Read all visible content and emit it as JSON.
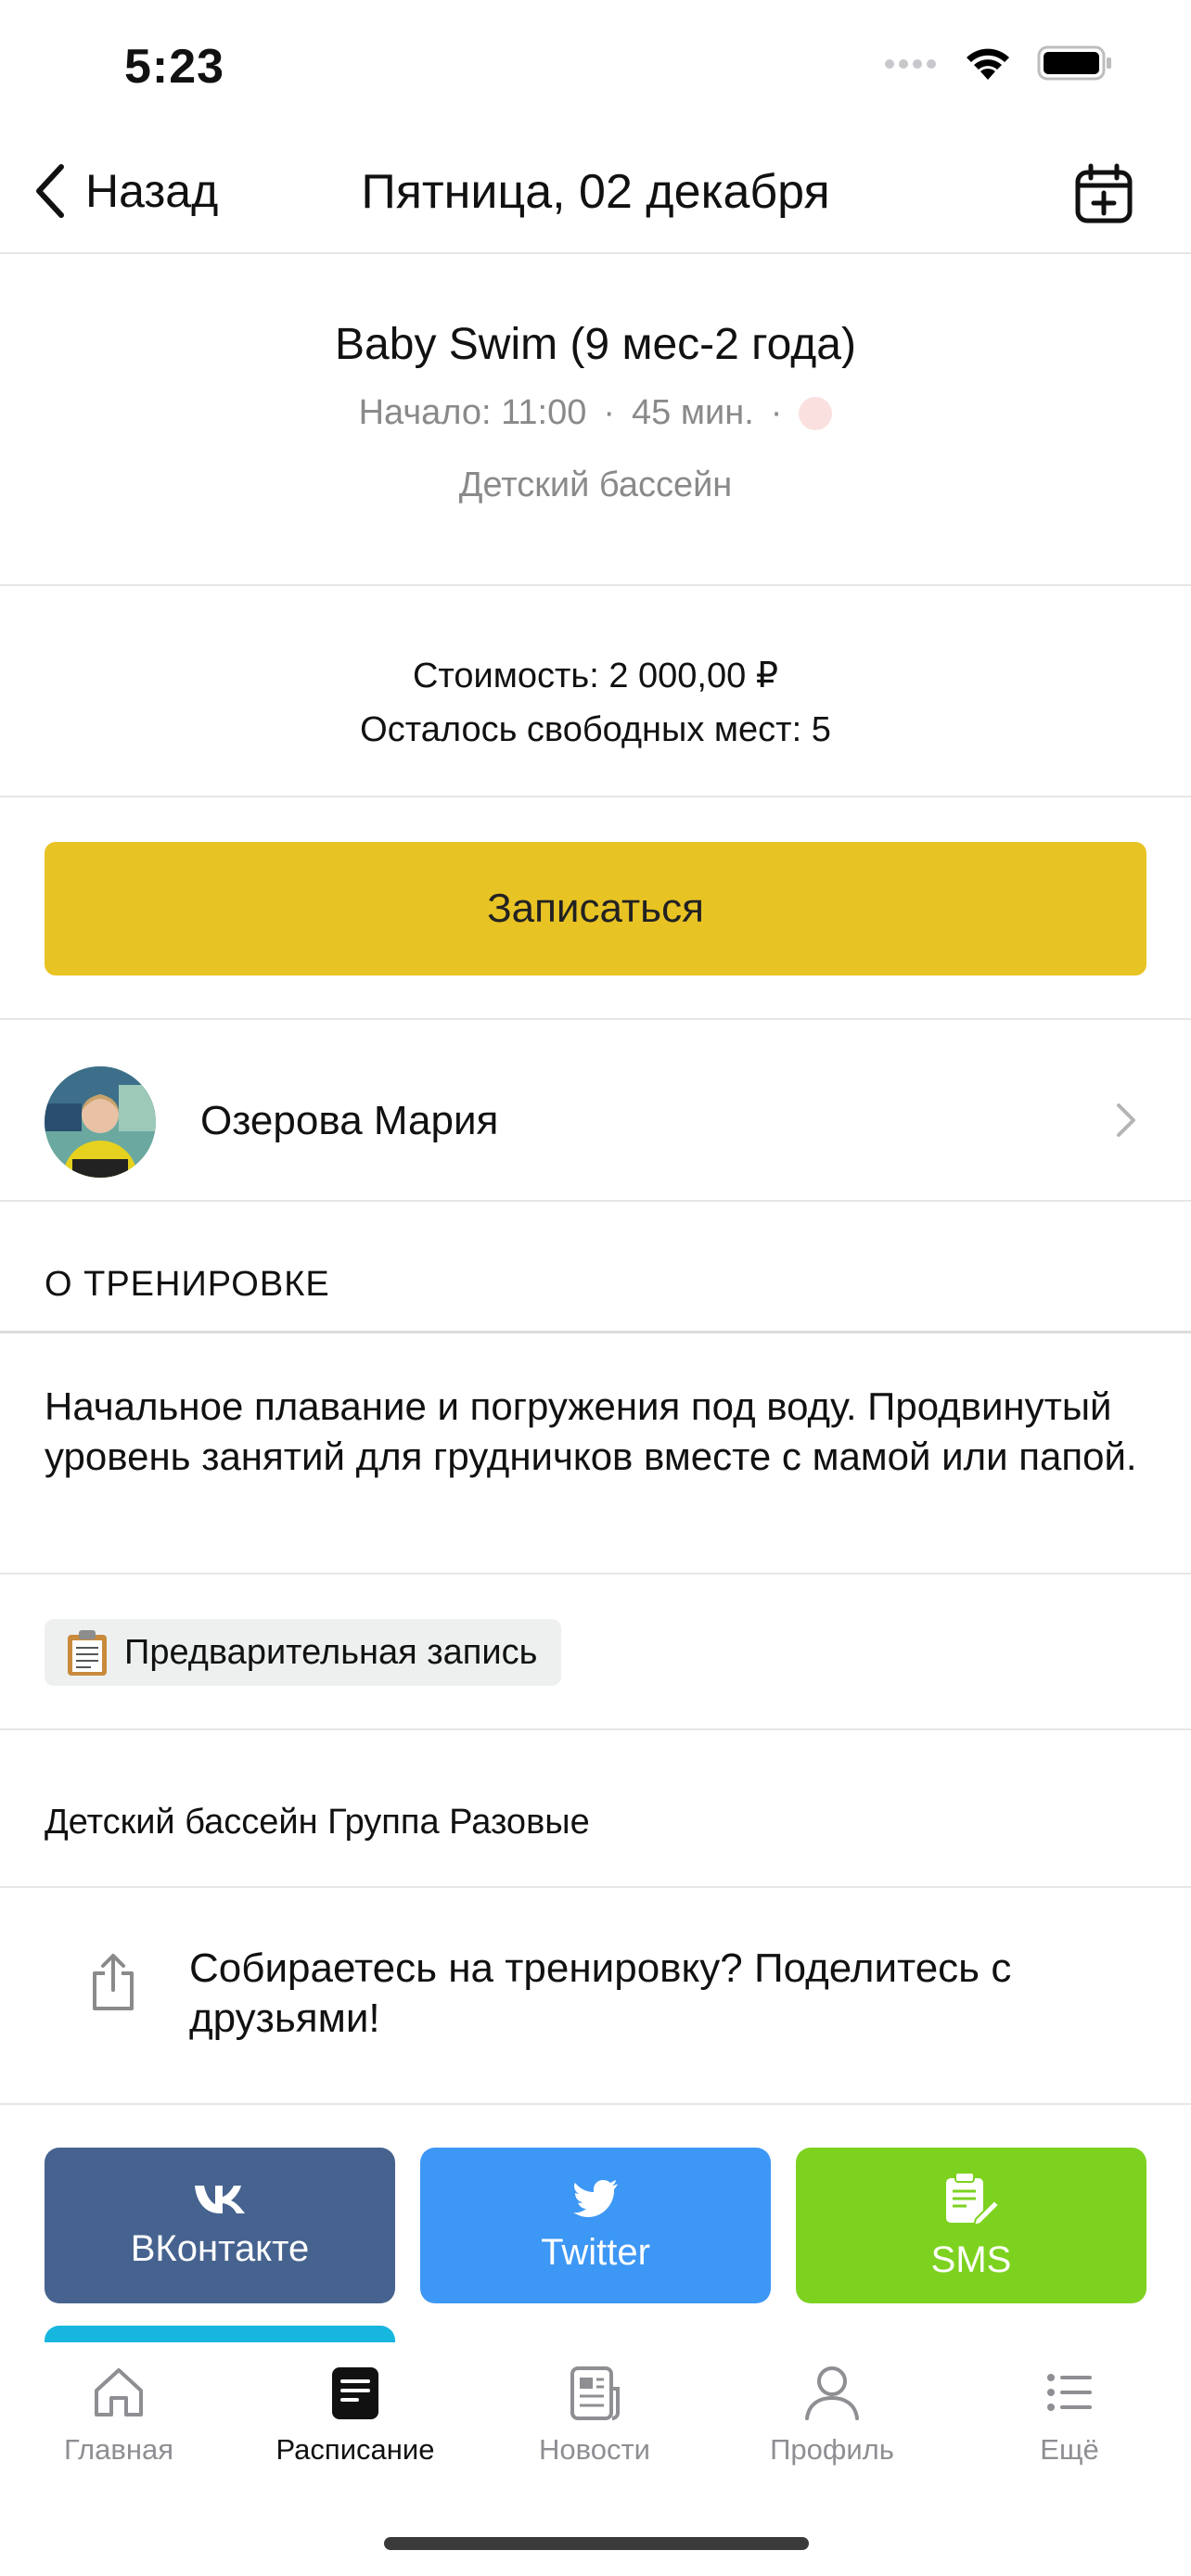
{
  "status_bar": {
    "time": "5:23",
    "icons": [
      "signal-icon",
      "wifi-icon",
      "battery-icon"
    ]
  },
  "nav": {
    "back_label": "Назад",
    "title": "Пятница, 02 декабря",
    "calendar_icon": "calendar-add-icon"
  },
  "class_info": {
    "title": "Baby Swim (9 мес-2 года)",
    "start": "Начало: 11:00",
    "separator": "·",
    "duration": "45 мин.",
    "location": "Детский бассейн",
    "status_color": "#fbe0e0"
  },
  "pricing": {
    "cost": "Стоимость: 2 000,00 ₽",
    "spots": "Осталось свободных мест: 5"
  },
  "signup": {
    "label": "Записаться",
    "color": "#e8c324"
  },
  "trainer": {
    "name": "Озерова  Мария"
  },
  "about": {
    "header": "О ТРЕНИРОВКЕ",
    "description": "Начальное плавание и погружения под воду. Продвинутый уровень занятий для грудничков вместе с мамой или папой."
  },
  "tag": {
    "icon": "clipboard-icon",
    "label": "Предварительная запись"
  },
  "groups": {
    "text": "Детский бассейн Группа Разовые"
  },
  "share": {
    "prompt": "Собираетесь на тренировку? Поделитесь с друзьями!",
    "buttons": [
      {
        "label": "ВКонтакте",
        "icon": "vk-icon",
        "color": "#46638f"
      },
      {
        "label": "Twitter",
        "icon": "twitter-icon",
        "color": "#3d97f5"
      },
      {
        "label": "SMS",
        "icon": "sms-icon",
        "color": "#7dd21f"
      }
    ]
  },
  "tabs": [
    {
      "label": "Главная",
      "icon": "home-icon",
      "active": false
    },
    {
      "label": "Расписание",
      "icon": "schedule-icon",
      "active": true
    },
    {
      "label": "Новости",
      "icon": "news-icon",
      "active": false
    },
    {
      "label": "Профиль",
      "icon": "profile-icon",
      "active": false
    },
    {
      "label": "Ещё",
      "icon": "more-icon",
      "active": false
    }
  ]
}
